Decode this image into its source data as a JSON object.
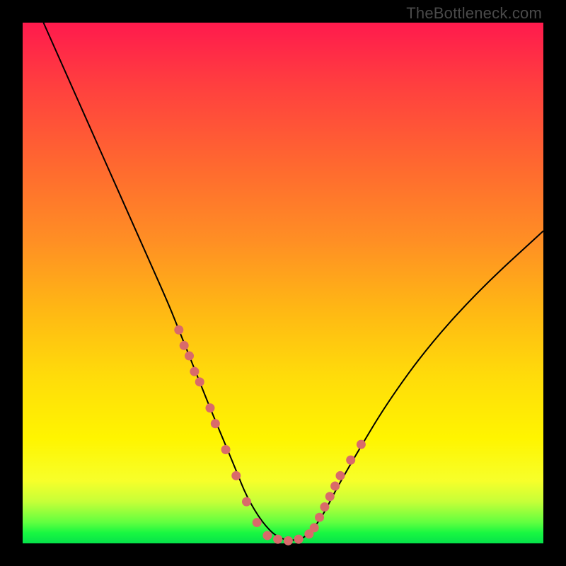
{
  "watermark": "TheBottleneck.com",
  "chart_data": {
    "type": "line",
    "title": "",
    "xlabel": "",
    "ylabel": "",
    "xlim": [
      0,
      100
    ],
    "ylim": [
      0,
      100
    ],
    "series": [
      {
        "name": "bottleneck-curve",
        "x": [
          4,
          8,
          12,
          16,
          20,
          24,
          28,
          30,
          32,
          34,
          36,
          38.5,
          41,
          43,
          46,
          49,
          52,
          54,
          56,
          58,
          60,
          64,
          70,
          78,
          88,
          100
        ],
        "y": [
          100,
          91,
          82,
          73,
          64,
          55,
          46,
          41,
          36,
          31,
          26,
          20,
          14,
          9,
          4,
          1,
          0.5,
          1,
          3,
          6,
          10,
          17,
          27,
          38,
          49,
          60
        ]
      }
    ],
    "markers": [
      {
        "name": "dots-left-branch",
        "color": "#d96a6a",
        "points": [
          {
            "x": 30,
            "y": 41
          },
          {
            "x": 31,
            "y": 38
          },
          {
            "x": 32,
            "y": 36
          },
          {
            "x": 33,
            "y": 33
          },
          {
            "x": 34,
            "y": 31
          },
          {
            "x": 36,
            "y": 26
          },
          {
            "x": 37,
            "y": 23
          },
          {
            "x": 39,
            "y": 18
          },
          {
            "x": 41,
            "y": 13
          },
          {
            "x": 43,
            "y": 8
          },
          {
            "x": 45,
            "y": 4
          }
        ]
      },
      {
        "name": "dots-valley",
        "color": "#d96a6a",
        "points": [
          {
            "x": 47,
            "y": 1.5
          },
          {
            "x": 49,
            "y": 0.8
          },
          {
            "x": 51,
            "y": 0.5
          },
          {
            "x": 53,
            "y": 0.8
          },
          {
            "x": 55,
            "y": 1.8
          }
        ]
      },
      {
        "name": "dots-right-branch",
        "color": "#d96a6a",
        "points": [
          {
            "x": 56,
            "y": 3
          },
          {
            "x": 57,
            "y": 5
          },
          {
            "x": 58,
            "y": 7
          },
          {
            "x": 59,
            "y": 9
          },
          {
            "x": 60,
            "y": 11
          },
          {
            "x": 61,
            "y": 13
          },
          {
            "x": 63,
            "y": 16
          },
          {
            "x": 65,
            "y": 19
          }
        ]
      }
    ]
  }
}
